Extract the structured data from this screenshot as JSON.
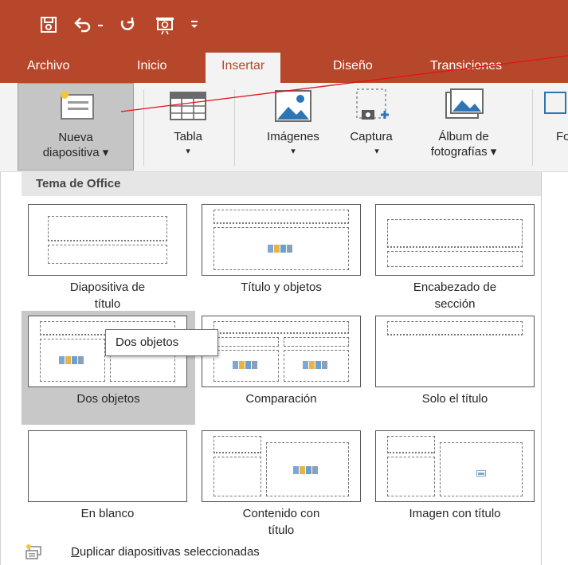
{
  "quick_access": {
    "icons": [
      "save-icon",
      "undo-icon",
      "undo-dropdown-icon",
      "redo-icon",
      "present-icon",
      "customize-qat-icon"
    ]
  },
  "tabs": [
    {
      "label": "Archivo"
    },
    {
      "label": "Inicio"
    },
    {
      "label": "Insertar",
      "active": true
    },
    {
      "label": "Diseño"
    },
    {
      "label": "Transiciones"
    }
  ],
  "ribbon": {
    "new_slide_line1": "Nueva",
    "new_slide_line2": "diapositiva ▾",
    "table_label": "Tabla",
    "table_arrow": "▾",
    "images_label": "Imágenes",
    "images_arrow": "▾",
    "capture_label": "Captura",
    "capture_arrow": "▾",
    "album_line1": "Álbum de",
    "album_line2": "fotografías ▾",
    "cutoff_label": "Fo"
  },
  "panel": {
    "header": "Tema de Office",
    "layouts": [
      {
        "line1": "Diapositiva de",
        "line2": "título"
      },
      {
        "line1": "Título y objetos",
        "line2": ""
      },
      {
        "line1": "Encabezado de",
        "line2": "sección"
      },
      {
        "line1": "Dos objetos",
        "line2": ""
      },
      {
        "line1": "Comparación",
        "line2": ""
      },
      {
        "line1": "Solo el título",
        "line2": ""
      },
      {
        "line1": "En blanco",
        "line2": ""
      },
      {
        "line1": "Contenido con",
        "line2": "título"
      },
      {
        "line1": "Imagen con título",
        "line2": ""
      }
    ],
    "tooltip": "Dos objetos",
    "footer_underlined": "D",
    "footer_rest": "uplicar diapositivas seleccionadas"
  },
  "colors": {
    "accent": "#b7472a",
    "ribbon_bg": "#f3f3f3",
    "hover": "#c8c8c8"
  }
}
